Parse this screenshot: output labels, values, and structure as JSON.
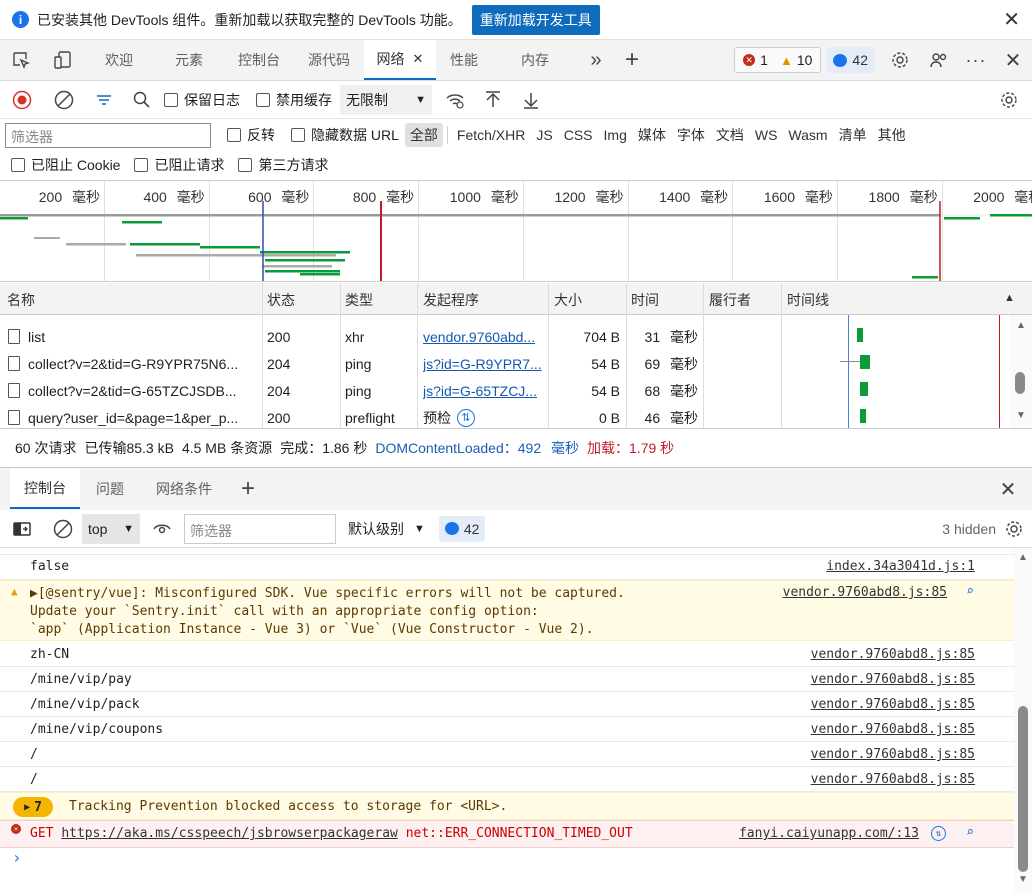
{
  "infobar": {
    "message": "已安装其他 DevTools 组件。重新加载以获取完整的 DevTools 功能。",
    "reload_button": "重新加载开发工具",
    "close": "✕"
  },
  "tabs": {
    "items": [
      "欢迎",
      "元素",
      "控制台",
      "源代码",
      "网络",
      "性能",
      "内存"
    ],
    "active": "网络",
    "more": "»",
    "add": "+",
    "errors_count": "1",
    "warnings_count": "10",
    "issues_count": "42"
  },
  "network_toolbar": {
    "preserve_log": "保留日志",
    "disable_cache": "禁用缓存",
    "throttle": "无限制"
  },
  "filter_row": {
    "placeholder": "筛选器",
    "invert": "反转",
    "hide_data_urls": "隐藏数据 URL",
    "types": [
      "全部",
      "Fetch/XHR",
      "JS",
      "CSS",
      "Img",
      "媒体",
      "字体",
      "文档",
      "WS",
      "Wasm",
      "清单",
      "其他"
    ],
    "active_type": "全部"
  },
  "filter_row2": {
    "blocked_cookies": "已阻止 Cookie",
    "blocked_requests": "已阻止请求",
    "third_party": "第三方请求"
  },
  "overview": {
    "ticks": [
      "200 毫秒",
      "400 毫秒",
      "600 毫秒",
      "800 毫秒",
      "1000 毫秒",
      "1200 毫秒",
      "1400 毫秒",
      "1600 毫秒",
      "1800 毫秒",
      "2000 毫秒"
    ]
  },
  "table": {
    "headers": {
      "name": "名称",
      "status": "状态",
      "type": "类型",
      "initiator": "发起程序",
      "size": "大小",
      "time": "时间",
      "fulfilled_by": "履行者",
      "waterfall": "时间线"
    },
    "rows": [
      {
        "name": "list",
        "status": "200",
        "type": "xhr",
        "initiator": "vendor.9760abd...",
        "size": "704 B",
        "time": "31 毫秒"
      },
      {
        "name": "collect?v=2&tid=G-R9YPR75N6...",
        "status": "204",
        "type": "ping",
        "initiator": "js?id=G-R9YPR7...",
        "size": "54 B",
        "time": "69 毫秒"
      },
      {
        "name": "collect?v=2&tid=G-65TZCJSDB...",
        "status": "204",
        "type": "ping",
        "initiator": "js?id=G-65TZCJ...",
        "size": "54 B",
        "time": "68 毫秒"
      },
      {
        "name": "query?user_id=&page=1&per_p...",
        "status": "200",
        "type": "preflight",
        "initiator": "预检",
        "size": "0 B",
        "time": "46 毫秒"
      }
    ]
  },
  "summary": {
    "requests": "60 次请求",
    "transferred": "已传输85.3 kB",
    "resources": "4.5 MB 条资源",
    "finish": "完成：1.86 秒",
    "dcl_label": "DOMContentLoaded：",
    "dcl_value": "492 毫秒",
    "load_label": "加载：",
    "load_value": "1.79 秒"
  },
  "drawer": {
    "tabs": [
      "控制台",
      "问题",
      "网络条件"
    ],
    "active": "控制台",
    "add": "+",
    "close": "✕"
  },
  "console_toolbar": {
    "context": "top",
    "filter_placeholder": "筛选器",
    "level": "默认级别",
    "issues": "42",
    "hidden": "3 hidden"
  },
  "console": {
    "rows": [
      {
        "kind": "log",
        "text": "false",
        "source": "index.34a3041d.js:1"
      },
      {
        "kind": "warn",
        "text": "▶[@sentry/vue]: Misconfigured SDK. Vue specific errors will not be captured.\nUpdate your `Sentry.init` call with an appropriate config option:\n`app` (Application Instance - Vue 3) or `Vue` (Vue Constructor - Vue 2).",
        "source": "vendor.9760abd8.js:85"
      },
      {
        "kind": "log",
        "text": "zh-CN",
        "source": "vendor.9760abd8.js:85"
      },
      {
        "kind": "log",
        "text": "/mine/vip/pay",
        "source": "vendor.9760abd8.js:85"
      },
      {
        "kind": "log",
        "text": "/mine/vip/pack",
        "source": "vendor.9760abd8.js:85"
      },
      {
        "kind": "log",
        "text": "/mine/vip/coupons",
        "source": "vendor.9760abd8.js:85"
      },
      {
        "kind": "log",
        "text": "/",
        "source": "vendor.9760abd8.js:85"
      },
      {
        "kind": "log",
        "text": "/",
        "source": "vendor.9760abd8.js:85"
      },
      {
        "kind": "warn-group",
        "count": "7",
        "text": "Tracking Prevention blocked access to storage for <URL>."
      },
      {
        "kind": "error",
        "method": "GET",
        "url": "https://aka.ms/csspeech/jsbrowserpackageraw",
        "text": "net::ERR_CONNECTION_TIMED_OUT",
        "source": "fanyi.caiyunapp.com/:13"
      }
    ],
    "prompt": "›"
  },
  "colors": {
    "accent": "#0f6cbd",
    "error": "#c00000",
    "warning_bg": "#fffbe5",
    "dcl_blue": "#1a5fb4",
    "load_red": "#c01c28"
  }
}
